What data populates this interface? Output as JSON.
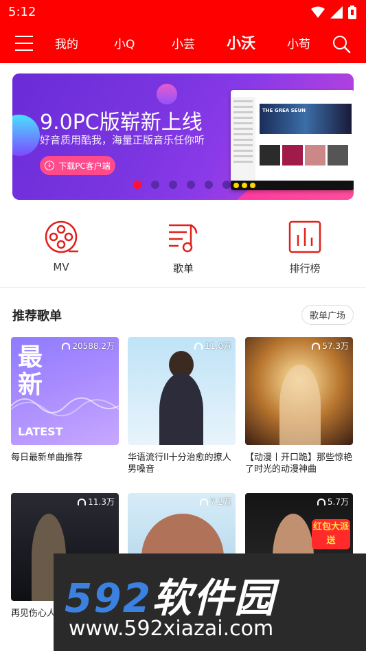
{
  "status_bar": {
    "time": "5:12"
  },
  "header": {
    "tabs": [
      {
        "label": "我的"
      },
      {
        "label": "小Q"
      },
      {
        "label": "小芸"
      },
      {
        "label": "小沃",
        "active": true
      },
      {
        "label": "小苟"
      }
    ]
  },
  "banner": {
    "title": "9.0PC版崭新上线",
    "subtitle": "好音质用酷我，海量正版音乐任你听",
    "button_label": "下载PC客户端",
    "dots_total": 6,
    "active_dot": 0,
    "mock_hero_text": "THE GREA SEUN"
  },
  "quick_links": [
    {
      "label": "MV",
      "icon": "film-reel-icon"
    },
    {
      "label": "歌单",
      "icon": "playlist-note-icon"
    },
    {
      "label": "排行榜",
      "icon": "chart-bars-icon"
    }
  ],
  "section": {
    "title": "推荐歌单",
    "more_label": "歌单广场"
  },
  "playlists": [
    {
      "plays": "20588.2万",
      "title": "每日最新单曲推荐",
      "cover_text_1": "最",
      "cover_text_2": "新",
      "cover_latest": "LATEST"
    },
    {
      "plays": "11.0万",
      "title": "华语流行II十分治愈的撩人男嗓音"
    },
    {
      "plays": "57.3万",
      "title": "【动漫丨开口跪】那些惊艳了时光的动漫神曲"
    },
    {
      "plays": "11.3万",
      "title": "再见伤心人歌赏析"
    },
    {
      "plays": "7.2万",
      "title": ""
    },
    {
      "plays": "5.7万",
      "title": "",
      "badge": "红包大派送"
    }
  ],
  "watermark": {
    "title_num": "592",
    "title_cn": "软件园",
    "url": "www.592xiazai.com"
  },
  "colors": {
    "brand_red": "#ff0000",
    "dot_active": "#ff1030",
    "banner_purple": "#7a35e0"
  }
}
